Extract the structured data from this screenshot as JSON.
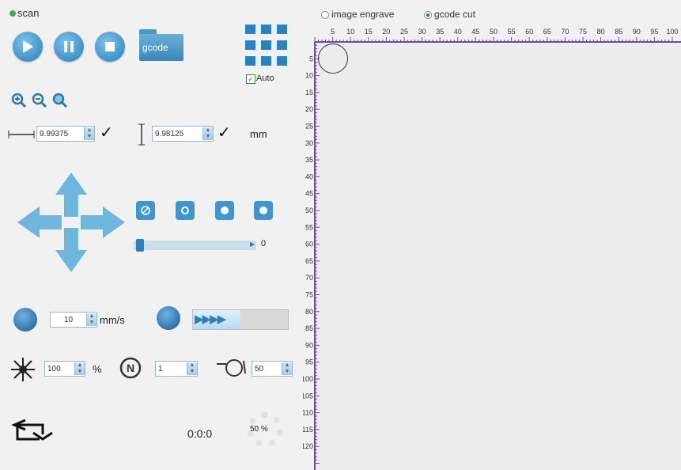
{
  "top": {
    "scan_label": "scan"
  },
  "toolbar": {
    "gcode_label": "gcode",
    "auto_label": "Auto",
    "auto_checked": true
  },
  "dimensions": {
    "width_value": "9.99375",
    "height_value": "9.98125",
    "unit": "mm"
  },
  "jog": {
    "slider_value": "0"
  },
  "speed": {
    "value": "10",
    "unit": "mm/s"
  },
  "laser": {
    "power_value": "100",
    "power_unit": "%",
    "passes_value": "1",
    "third_value": "50"
  },
  "status": {
    "elapsed_time": "0:0:0",
    "progress_percent": "50 %"
  },
  "modes": {
    "options": [
      {
        "label": "image engrave",
        "selected": false
      },
      {
        "label": "gcode cut",
        "selected": true
      }
    ]
  },
  "ruler": {
    "x_ticks": [
      "5",
      "10",
      "15",
      "20",
      "25",
      "30",
      "35",
      "40",
      "45",
      "50",
      "55",
      "60",
      "65",
      "70",
      "75",
      "80",
      "85",
      "90",
      "95",
      "100"
    ],
    "y_ticks": [
      "5",
      "10",
      "15",
      "20",
      "25",
      "30",
      "35",
      "40",
      "45",
      "50",
      "55",
      "60",
      "65",
      "70",
      "75",
      "80",
      "85",
      "90",
      "95",
      "100",
      "105",
      "110",
      "115",
      "120"
    ]
  },
  "colors": {
    "accent": "#3f93c8",
    "ruler_purple": "#6a4aa8",
    "active_green": "#36b24a"
  }
}
